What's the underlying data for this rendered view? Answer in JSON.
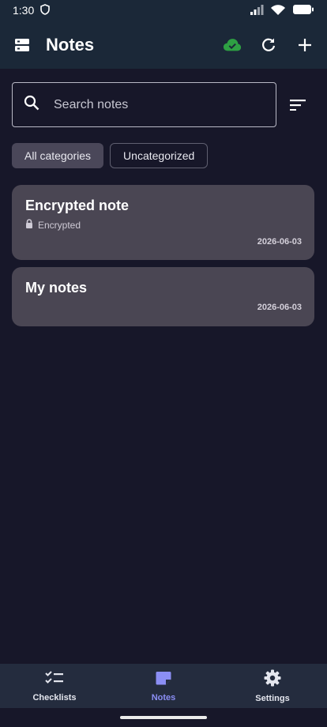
{
  "status_bar": {
    "time": "1:30"
  },
  "app_bar": {
    "title": "Notes",
    "sync_color": "#2ea043"
  },
  "search": {
    "placeholder": "Search notes"
  },
  "filters": {
    "chips": [
      {
        "label": "All categories",
        "selected": true
      },
      {
        "label": "Uncategorized",
        "selected": false
      }
    ]
  },
  "notes": [
    {
      "title": "Encrypted note",
      "subtitle": "Encrypted",
      "date": "2026-06-03",
      "icon": "lock-icon"
    },
    {
      "title": "My notes",
      "date": "2026-06-03"
    }
  ],
  "bottom_nav": {
    "items": [
      {
        "label": "Checklists",
        "icon": "checklist-icon"
      },
      {
        "label": "Notes",
        "icon": "note-icon",
        "active": true
      },
      {
        "label": "Settings",
        "icon": "gear-icon"
      }
    ],
    "active_color": "#8b8ef4"
  }
}
